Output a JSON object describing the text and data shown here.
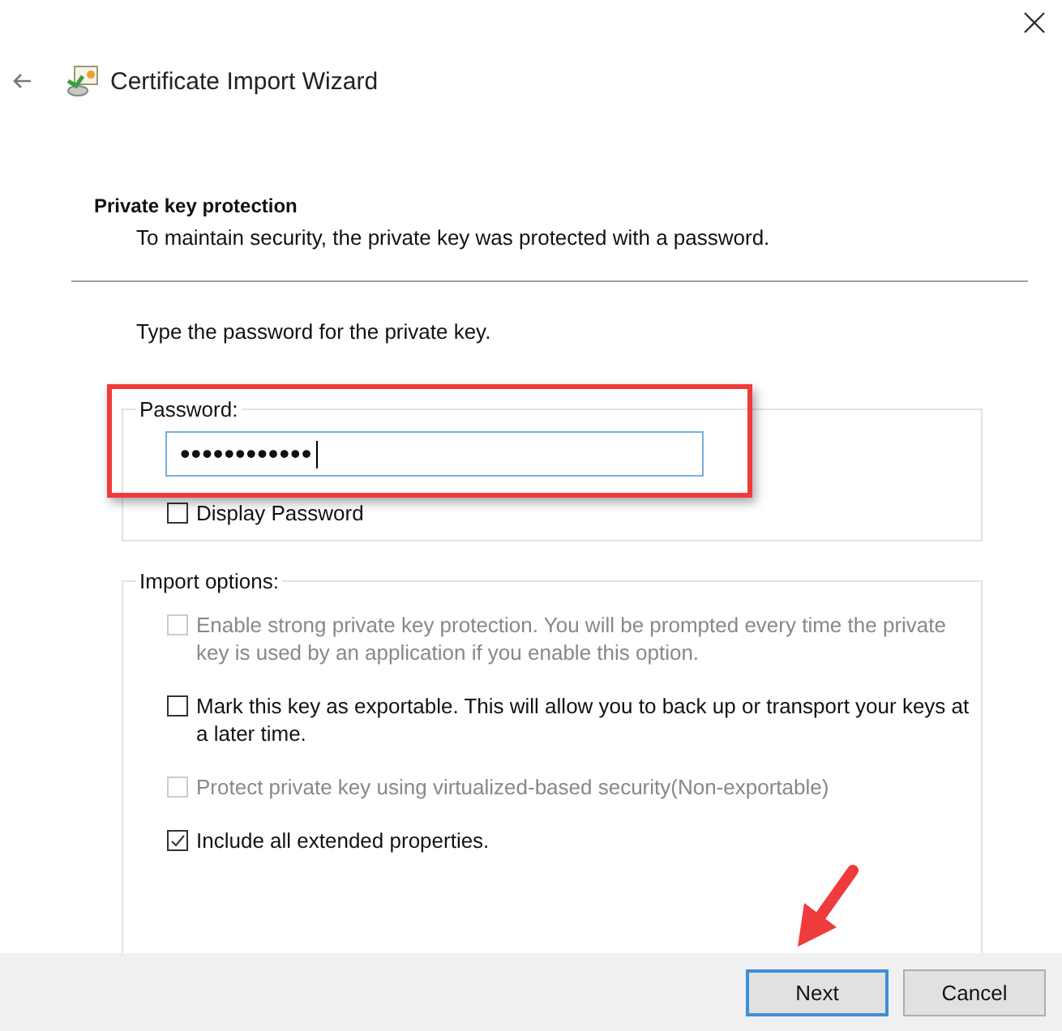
{
  "header": {
    "title": "Certificate Import Wizard"
  },
  "section": {
    "heading": "Private key protection",
    "description": "To maintain security, the private key was protected with a password."
  },
  "prompt": "Type the password for the private key.",
  "password_group": {
    "label": "Password:",
    "value": "••••••••••••",
    "display_password": {
      "label": "Display Password",
      "checked": false
    }
  },
  "import_options": {
    "label": "Import options:",
    "options": [
      {
        "label": "Enable strong private key protection. You will be prompted every time the private key is used by an application if you enable this option.",
        "checked": false,
        "disabled": true
      },
      {
        "label": "Mark this key as exportable. This will allow you to back up or transport your keys at a later time.",
        "checked": false,
        "disabled": false
      },
      {
        "label": "Protect private key using virtualized-based security(Non-exportable)",
        "checked": false,
        "disabled": true
      },
      {
        "label": "Include all extended properties.",
        "checked": true,
        "disabled": false
      }
    ]
  },
  "buttons": [
    {
      "label": "Next",
      "default": true
    },
    {
      "label": "Cancel",
      "default": false
    }
  ]
}
